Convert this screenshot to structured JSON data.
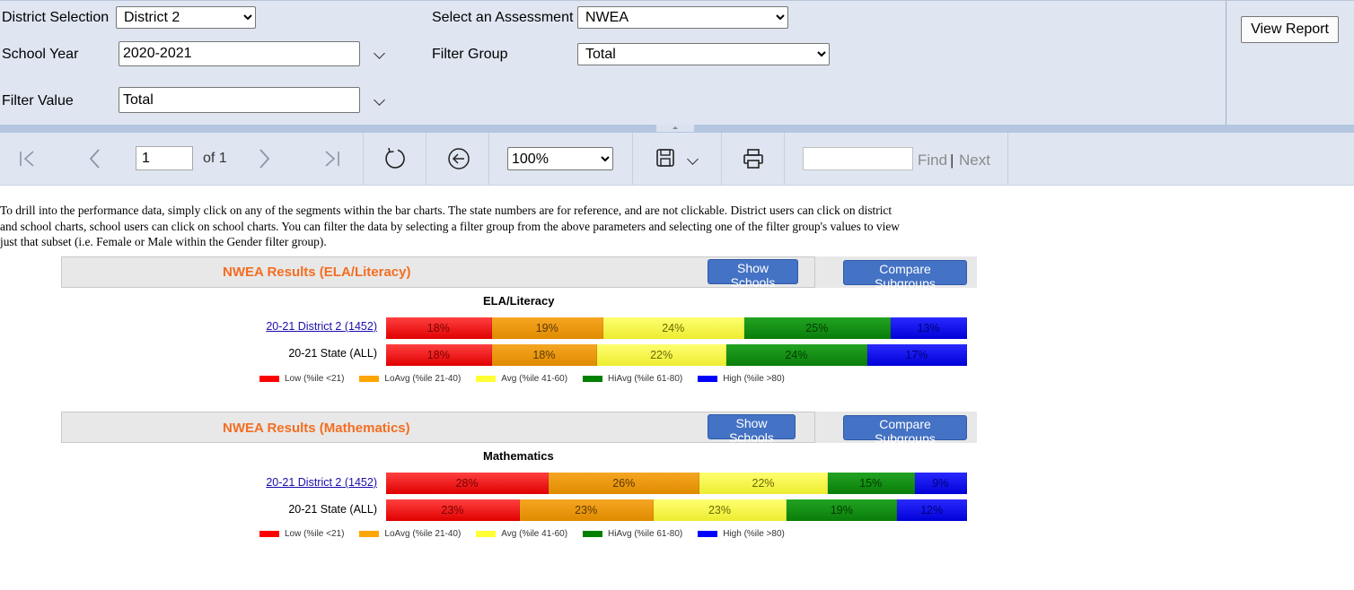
{
  "params": {
    "district_label": "District Selection",
    "district_value": "District 2",
    "assessment_label": "Select an Assessment",
    "assessment_value": "NWEA",
    "year_label": "School Year",
    "year_value": "2020-2021",
    "filter_group_label": "Filter Group",
    "filter_group_value": "Total",
    "filter_value_label": "Filter Value",
    "filter_value_value": "Total",
    "view_report": "View Report"
  },
  "toolbar": {
    "page_value": "1",
    "page_of": "of 1",
    "zoom_value": "100%",
    "find": "Find",
    "separator": "|",
    "next": "Next",
    "icons": [
      "first-page-icon",
      "previous-page-icon",
      "next-page-icon",
      "last-page-icon",
      "refresh-icon",
      "back-icon",
      "save-icon",
      "print-icon"
    ]
  },
  "intro_text": "To drill into the performance data, simply click on any of the segments within the bar charts.  The state numbers are for reference, and are not clickable.  District users can click on district and school charts, school users can click on school charts.  You can filter the data by selecting a filter group from the above parameters and selecting one of the filter group's values to view just that subset (i.e. Female or Male within the Gender filter group).",
  "colors": {
    "low": "#ff0000",
    "loavg": "#ffa500",
    "avg": "#ffff33",
    "hiavg": "#008000",
    "high": "#0000ff",
    "section_title": "#f36e21",
    "button": "#4472c4"
  },
  "sections": [
    {
      "title": "NWEA Results (ELA/Literacy)",
      "show_schools": "Show Schools",
      "compare": "Compare Subgroups",
      "chart_title": "ELA/Literacy",
      "rows": [
        {
          "label": "20-21 District 2 (1452)",
          "link": true,
          "values": [
            18,
            19,
            24,
            25,
            13
          ],
          "texts": [
            "18%",
            "19%",
            "24%",
            "25%",
            "13%"
          ]
        },
        {
          "label": "20-21 State (ALL)",
          "link": false,
          "values": [
            18,
            18,
            22,
            24,
            17
          ],
          "texts": [
            "18%",
            "18%",
            "22%",
            "24%",
            "17%"
          ]
        }
      ]
    },
    {
      "title": "NWEA Results (Mathematics)",
      "show_schools": "Show Schools",
      "compare": "Compare Subgroups",
      "chart_title": "Mathematics",
      "rows": [
        {
          "label": "20-21 District 2 (1452)",
          "link": true,
          "values": [
            28,
            26,
            22,
            15,
            9
          ],
          "texts": [
            "28%",
            "26%",
            "22%",
            "15%",
            "9%"
          ]
        },
        {
          "label": "20-21 State (ALL)",
          "link": false,
          "values": [
            23,
            23,
            23,
            19,
            12
          ],
          "texts": [
            "23%",
            "23%",
            "23%",
            "19%",
            "12%"
          ]
        }
      ]
    }
  ],
  "legend": [
    {
      "key": "low",
      "label": "Low (%ile <21)"
    },
    {
      "key": "loavg",
      "label": "LoAvg (%ile 21-40)"
    },
    {
      "key": "avg",
      "label": "Avg (%ile 41-60)"
    },
    {
      "key": "hiavg",
      "label": "HiAvg (%ile 61-80)"
    },
    {
      "key": "high",
      "label": "High (%ile >80)"
    }
  ]
}
